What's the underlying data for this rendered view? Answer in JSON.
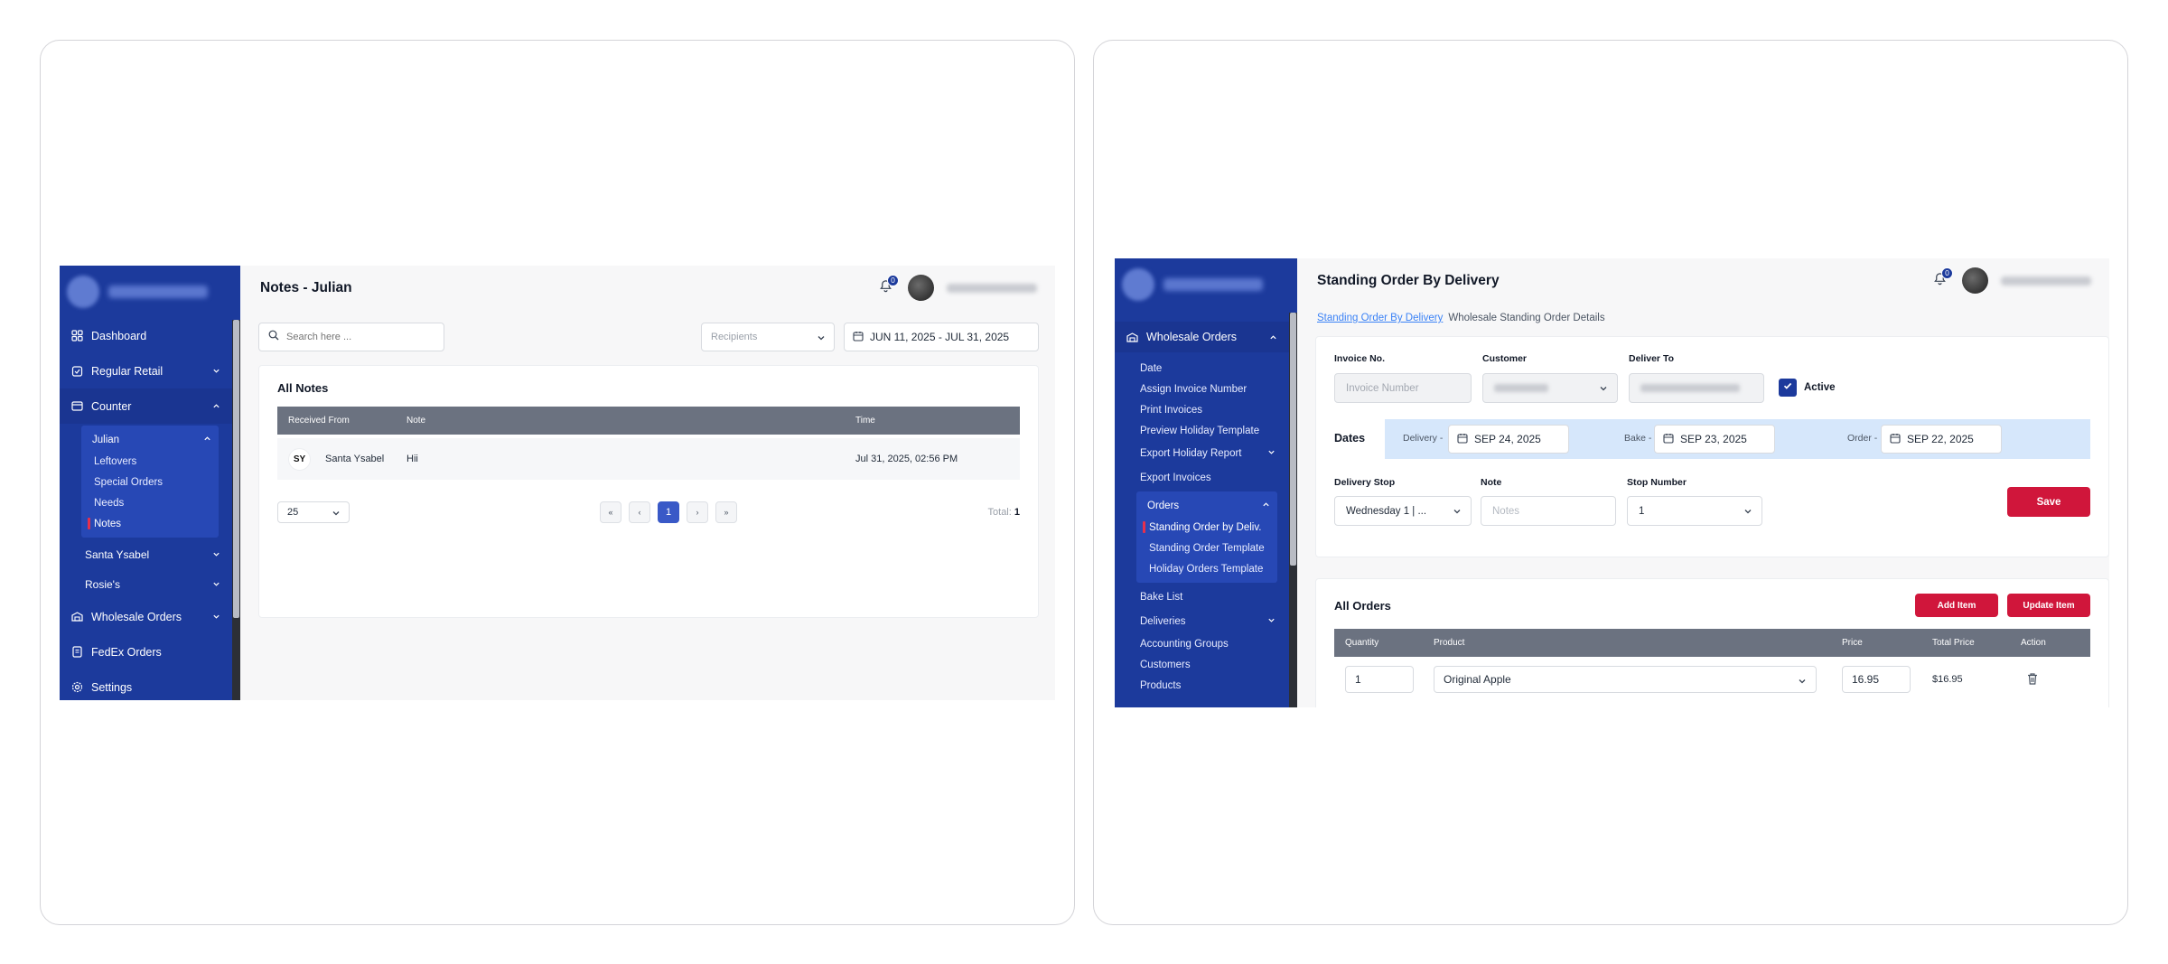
{
  "left_app": {
    "sidebar": {
      "items": [
        {
          "label": "Dashboard"
        },
        {
          "label": "Regular Retail"
        },
        {
          "label": "Counter"
        }
      ],
      "counter_group": {
        "label": "Julian",
        "children": [
          "Leftovers",
          "Special Orders",
          "Needs",
          "Notes"
        ]
      },
      "counter_children": [
        "Santa Ysabel",
        "Rosie's"
      ],
      "bottom_items": [
        {
          "label": "Wholesale Orders"
        },
        {
          "label": "FedEx Orders"
        },
        {
          "label": "Settings"
        }
      ]
    },
    "header": {
      "title": "Notes - Julian",
      "notification_count": "0"
    },
    "filters": {
      "search_placeholder": "Search here ...",
      "recipients_placeholder": "Recipients",
      "date_range": "JUN 11, 2025 - JUL 31, 2025"
    },
    "notes": {
      "title": "All Notes",
      "columns": [
        "Received From",
        "Note",
        "Time"
      ],
      "rows": [
        {
          "initials": "SY",
          "from": "Santa Ysabel",
          "note": "Hii",
          "time": "Jul 31, 2025, 02:56 PM"
        }
      ]
    },
    "pagination": {
      "page_size": "25",
      "buttons": [
        "«",
        "‹",
        "1",
        "›",
        "»"
      ],
      "total_label": "Total:",
      "total_value": "1"
    }
  },
  "right_app": {
    "sidebar": {
      "section": "Wholesale Orders",
      "items": [
        "Date",
        "Assign Invoice Number",
        "Print Invoices",
        "Preview Holiday Template"
      ],
      "export_report": "Export Holiday Report",
      "export_invoices": "Export Invoices",
      "orders_group": {
        "label": "Orders",
        "children": [
          "Standing Order by Deliv.",
          "Standing Order Template",
          "Holiday Orders Template"
        ]
      },
      "bake_list": "Bake List",
      "deliveries": "Deliveries",
      "after_items": [
        "Accounting Groups",
        "Customers",
        "Products"
      ]
    },
    "header": {
      "title": "Standing Order By Delivery",
      "notification_count": "0"
    },
    "breadcrumb": {
      "link": "Standing Order By Delivery",
      "current": "Wholesale Standing Order Details"
    },
    "form": {
      "invoice_label": "Invoice No.",
      "invoice_placeholder": "Invoice Number",
      "customer_label": "Customer",
      "deliver_to_label": "Deliver To",
      "active_label": "Active",
      "dates_label": "Dates",
      "delivery_label": "Delivery -",
      "delivery_date": "SEP 24, 2025",
      "bake_label": "Bake -",
      "bake_date": "SEP 23, 2025",
      "order_label": "Order -",
      "order_date": "SEP 22, 2025",
      "delivery_stop_label": "Delivery Stop",
      "delivery_stop_value": "Wednesday 1 | ...",
      "note_label": "Note",
      "note_placeholder": "Notes",
      "stop_number_label": "Stop Number",
      "stop_number_value": "1",
      "save_label": "Save"
    },
    "orders": {
      "title": "All Orders",
      "add_label": "Add Item",
      "update_label": "Update Item",
      "columns": [
        "Quantity",
        "Product",
        "Price",
        "Total Price",
        "Action"
      ],
      "rows": [
        {
          "quantity": "1",
          "product": "Original Apple",
          "price": "16.95",
          "total": "$16.95"
        }
      ]
    }
  },
  "colors": {
    "sidebar": "#1c3a9c",
    "accent_red": "#d0163b",
    "table_head": "#6b7280",
    "pagination_active": "#3959c7",
    "dates_band": "#d6e7fb"
  }
}
